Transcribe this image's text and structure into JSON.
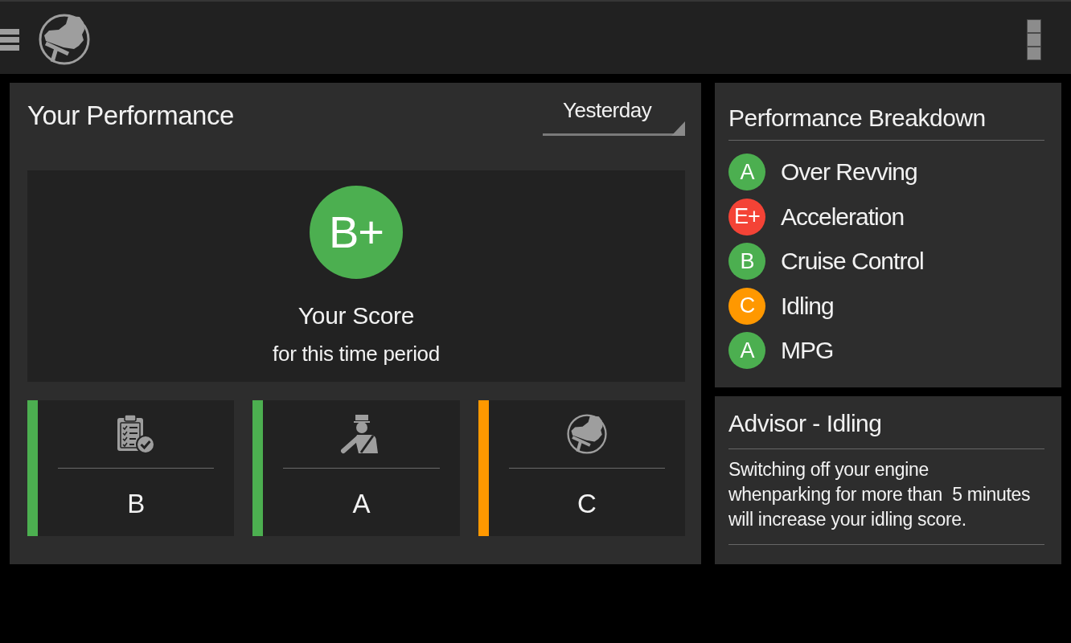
{
  "performance": {
    "title": "Your Performance",
    "period": {
      "value": "Yesterday"
    },
    "score": {
      "grade": "B+",
      "color": "#4caf50",
      "label": "Your Score",
      "caption": "for this time period"
    },
    "categories": [
      {
        "kind": "checklist",
        "grade": "B",
        "color": "#4caf50"
      },
      {
        "kind": "driver",
        "grade": "A",
        "color": "#4caf50"
      },
      {
        "kind": "pedal",
        "grade": "C",
        "color": "#ff9800"
      }
    ]
  },
  "breakdown": {
    "title": "Performance Breakdown",
    "items": [
      {
        "grade": "A",
        "label": "Over Revving",
        "color": "#4caf50"
      },
      {
        "grade": "E+",
        "label": "Acceleration",
        "color": "#f44336"
      },
      {
        "grade": "B",
        "label": "Cruise Control",
        "color": "#4caf50"
      },
      {
        "grade": "C",
        "label": "Idling",
        "color": "#ff9800"
      },
      {
        "grade": "A",
        "label": "MPG",
        "color": "#4caf50"
      }
    ]
  },
  "advisor": {
    "title": "Advisor - Idling",
    "lines": [
      "Switching off your engine",
      "whenparking for more than  5 minutes",
      "will increase your idling score."
    ]
  }
}
